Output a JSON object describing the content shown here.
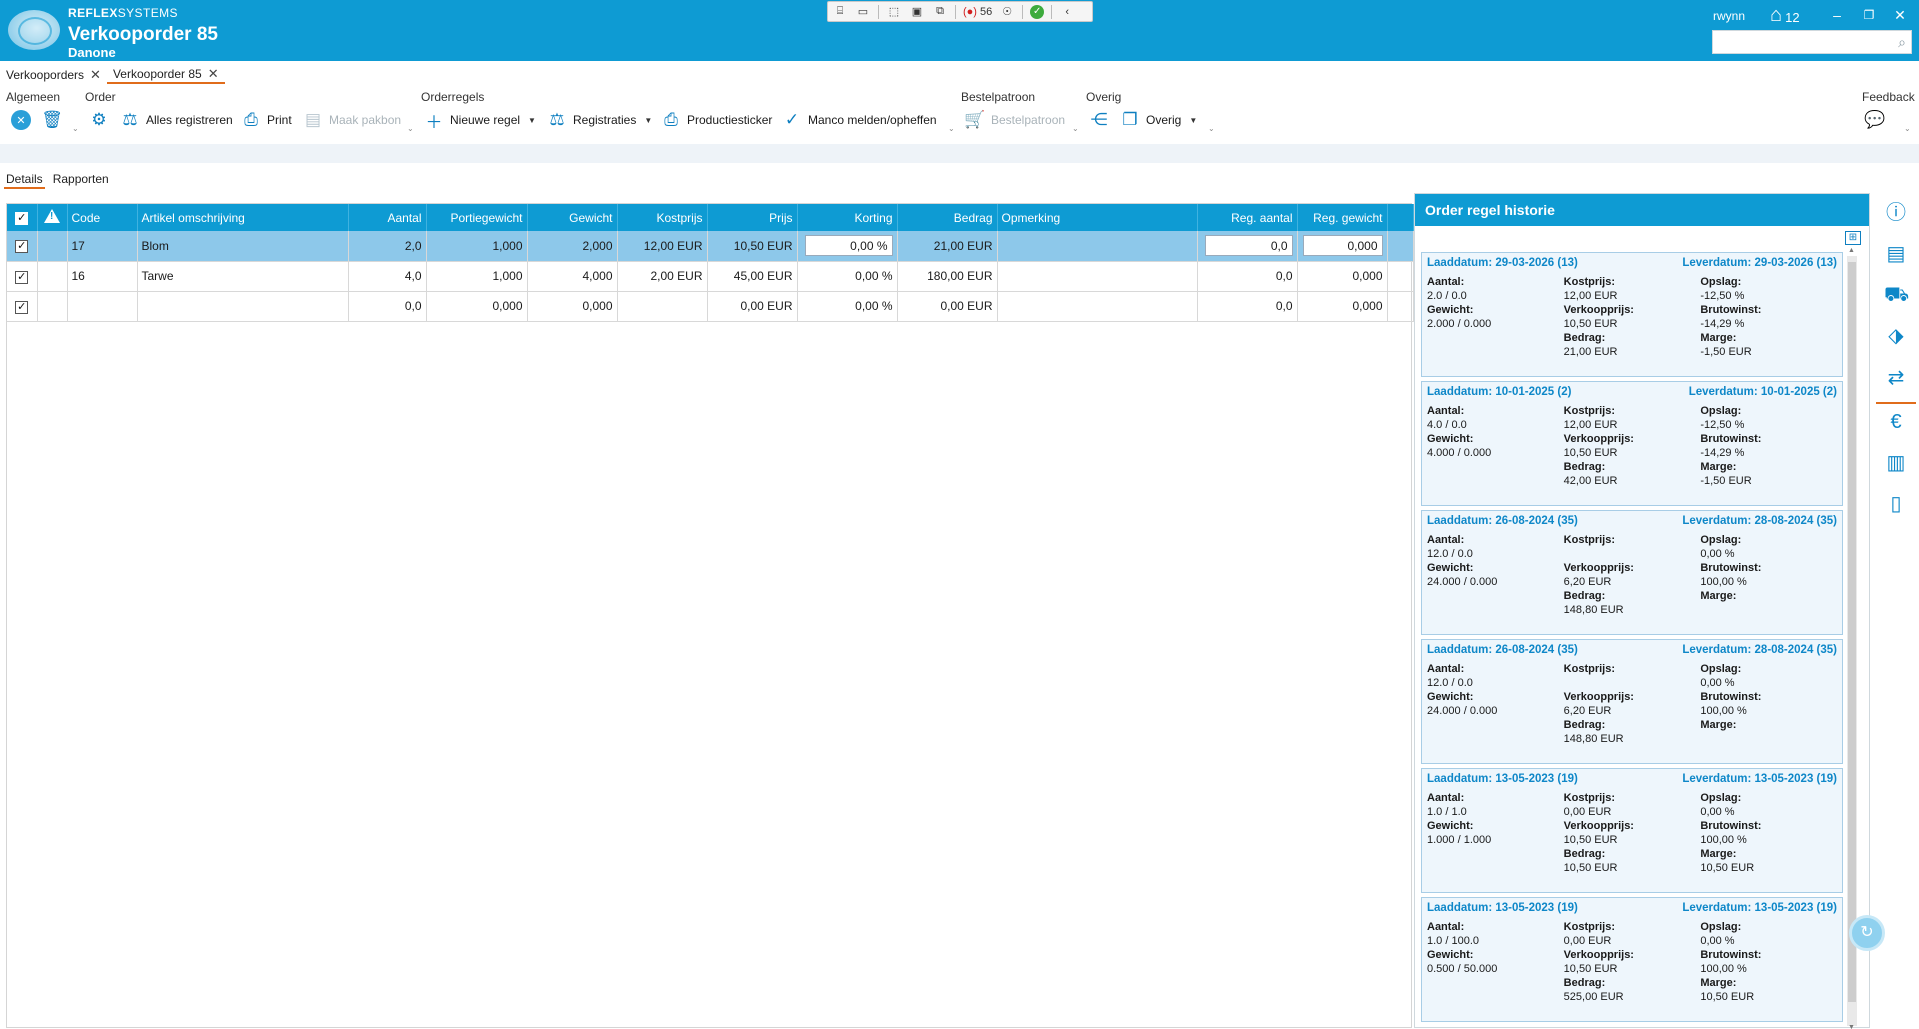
{
  "header": {
    "brand_bold": "REFLEX",
    "brand_rest": "SYSTEMS",
    "title": "Verkooporder 85",
    "subtitle": "Danone",
    "user": "rwynn",
    "home_count": "12",
    "search_placeholder": ""
  },
  "debug_toolbar": {
    "errors_count": "56"
  },
  "doc_tabs": [
    {
      "label": "Verkooporders"
    },
    {
      "label": "Verkooporder 85"
    }
  ],
  "ribbon": {
    "groups": {
      "algemeen": "Algemeen",
      "order": "Order",
      "orderregels": "Orderregels",
      "bestelpatroon": "Bestelpatroon",
      "overig": "Overig",
      "feedback": "Feedback"
    },
    "buttons": {
      "alles_registreren": "Alles registreren",
      "print": "Print",
      "maak_pakbon": "Maak pakbon",
      "nieuwe_regel": "Nieuwe regel",
      "registraties": "Registraties",
      "productiesticker": "Productiesticker",
      "manco": "Manco melden/opheffen",
      "bestelpatroon": "Bestelpatroon",
      "overig": "Overig"
    }
  },
  "subtabs": [
    {
      "label": "Details"
    },
    {
      "label": "Rapporten"
    }
  ],
  "grid": {
    "columns": [
      "Code",
      "Artikel omschrijving",
      "Aantal",
      "Portiegewicht",
      "Gewicht",
      "Kostprijs",
      "Prijs",
      "Korting",
      "Bedrag",
      "Opmerking",
      "Reg. aantal",
      "Reg. gewicht"
    ],
    "rows": [
      {
        "code": "17",
        "artikel": "Blom",
        "aantal": "2,0",
        "portie": "1,000",
        "gewicht": "2,000",
        "kostprijs": "12,00 EUR",
        "prijs": "10,50 EUR",
        "korting": "0,00 %",
        "bedrag": "21,00 EUR",
        "opmerking": "",
        "reg_aantal": "0,0",
        "reg_gewicht": "0,000"
      },
      {
        "code": "16",
        "artikel": "Tarwe",
        "aantal": "4,0",
        "portie": "1,000",
        "gewicht": "4,000",
        "kostprijs": "2,00 EUR",
        "prijs": "45,00 EUR",
        "korting": "0,00 %",
        "bedrag": "180,00 EUR",
        "opmerking": "",
        "reg_aantal": "0,0",
        "reg_gewicht": "0,000"
      },
      {
        "code": "",
        "artikel": "",
        "aantal": "0,0",
        "portie": "0,000",
        "gewicht": "0,000",
        "kostprijs": "",
        "prijs": "0,00 EUR",
        "korting": "0,00 %",
        "bedrag": "0,00 EUR",
        "opmerking": "",
        "reg_aantal": "0,0",
        "reg_gewicht": "0,000"
      }
    ]
  },
  "history": {
    "title": "Order regel historie",
    "labels": {
      "aantal": "Aantal:",
      "gewicht": "Gewicht:",
      "kostprijs": "Kostprijs:",
      "verkoopprijs": "Verkoopprijs:",
      "bedrag": "Bedrag:",
      "opslag": "Opslag:",
      "brutowinst": "Brutowinst:",
      "marge": "Marge:"
    },
    "cards": [
      {
        "laad": "Laaddatum: 29-03-2026 (13)",
        "lever": "Leverdatum: 29-03-2026 (13)",
        "aantal": "2.0 / 0.0",
        "gewicht": "2.000 / 0.000",
        "kostprijs": "12,00 EUR",
        "verkoopprijs": "10,50 EUR",
        "bedrag": "21,00 EUR",
        "opslag": "-12,50 %",
        "brutowinst": "-14,29 %",
        "marge": "-1,50 EUR"
      },
      {
        "laad": "Laaddatum: 10-01-2025 (2)",
        "lever": "Leverdatum: 10-01-2025 (2)",
        "aantal": "4.0 / 0.0",
        "gewicht": "4.000 / 0.000",
        "kostprijs": "12,00 EUR",
        "verkoopprijs": "10,50 EUR",
        "bedrag": "42,00 EUR",
        "opslag": "-12,50 %",
        "brutowinst": "-14,29 %",
        "marge": "-1,50 EUR"
      },
      {
        "laad": "Laaddatum: 26-08-2024 (35)",
        "lever": "Leverdatum: 28-08-2024 (35)",
        "aantal": "12.0 / 0.0",
        "gewicht": "24.000 / 0.000",
        "kostprijs": "",
        "verkoopprijs": "6,20 EUR",
        "bedrag": "148,80 EUR",
        "opslag": "0,00 %",
        "brutowinst": "100,00 %",
        "marge": ""
      },
      {
        "laad": "Laaddatum: 26-08-2024 (35)",
        "lever": "Leverdatum: 28-08-2024 (35)",
        "aantal": "12.0 / 0.0",
        "gewicht": "24.000 / 0.000",
        "kostprijs": "",
        "verkoopprijs": "6,20 EUR",
        "bedrag": "148,80 EUR",
        "opslag": "0,00 %",
        "brutowinst": "100,00 %",
        "marge": ""
      },
      {
        "laad": "Laaddatum: 13-05-2023 (19)",
        "lever": "Leverdatum: 13-05-2023 (19)",
        "aantal": "1.0 / 1.0",
        "gewicht": "1.000 / 1.000",
        "kostprijs": "0,00 EUR",
        "verkoopprijs": "10,50 EUR",
        "bedrag": "10,50 EUR",
        "opslag": "0,00 %",
        "brutowinst": "100,00 %",
        "marge": "10,50 EUR"
      },
      {
        "laad": "Laaddatum: 13-05-2023 (19)",
        "lever": "Leverdatum: 13-05-2023 (19)",
        "aantal": "1.0 / 100.0",
        "gewicht": "0.500 / 50.000",
        "kostprijs": "0,00 EUR",
        "verkoopprijs": "10,50 EUR",
        "bedrag": "525,00 EUR",
        "opslag": "0,00 %",
        "brutowinst": "100,00 %",
        "marge": "10,50 EUR"
      }
    ]
  },
  "icons": {
    "sidebar": [
      "info-icon",
      "document-list-icon",
      "delivery-truck-icon",
      "tag-icon",
      "route-icon",
      "euro-icon",
      "document-icon",
      "notebook-icon"
    ]
  },
  "colors": {
    "accent": "#0e9bd3",
    "tab_underline": "#e06c1b",
    "selected_row": "#8dc8ea"
  }
}
